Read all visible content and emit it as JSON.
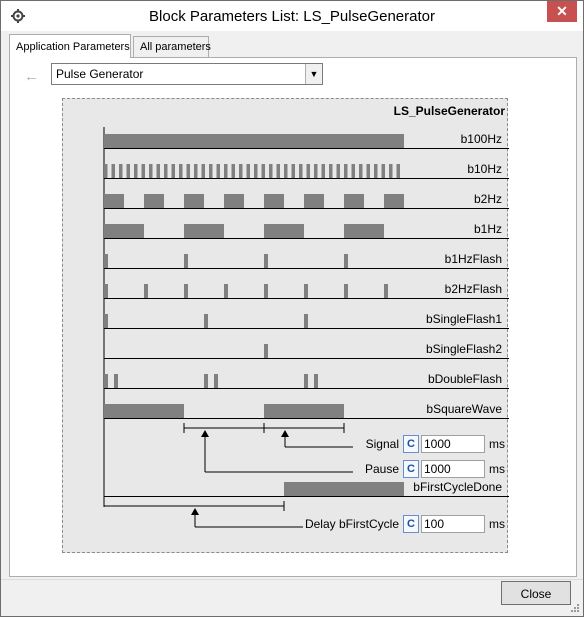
{
  "window": {
    "title": "Block Parameters List: LS_PulseGenerator",
    "close_glyph": "✕",
    "app_icon": "gear-icon"
  },
  "tabs": [
    {
      "label": "Application Parameters",
      "active": true
    },
    {
      "label": "All parameters",
      "active": false
    }
  ],
  "toolbar": {
    "back_icon": "left-arrow-icon",
    "block_select_value": "Pulse Generator"
  },
  "diagram": {
    "block_name": "LS_PulseGenerator",
    "signals": [
      {
        "name": "b100Hz"
      },
      {
        "name": "b10Hz"
      },
      {
        "name": "b2Hz"
      },
      {
        "name": "b1Hz"
      },
      {
        "name": "b1HzFlash"
      },
      {
        "name": "b2HzFlash"
      },
      {
        "name": "bSingleFlash1"
      },
      {
        "name": "bSingleFlash2"
      },
      {
        "name": "bDoubleFlash"
      },
      {
        "name": "bSquareWave"
      },
      {
        "name": "bFirstCycleDone"
      }
    ],
    "fields": {
      "signal": {
        "label": "Signal",
        "c_label": "C",
        "value": "1000",
        "unit": "ms"
      },
      "pause": {
        "label": "Pause",
        "c_label": "C",
        "value": "1000",
        "unit": "ms"
      },
      "delay": {
        "label": "Delay bFirstCycle",
        "c_label": "C",
        "value": "100",
        "unit": "ms"
      }
    }
  },
  "footer": {
    "close_label": "Close"
  },
  "colors": {
    "pulse": "#808080",
    "diagram_bg": "#e8e8e8",
    "title_close_bg": "#c75050"
  }
}
